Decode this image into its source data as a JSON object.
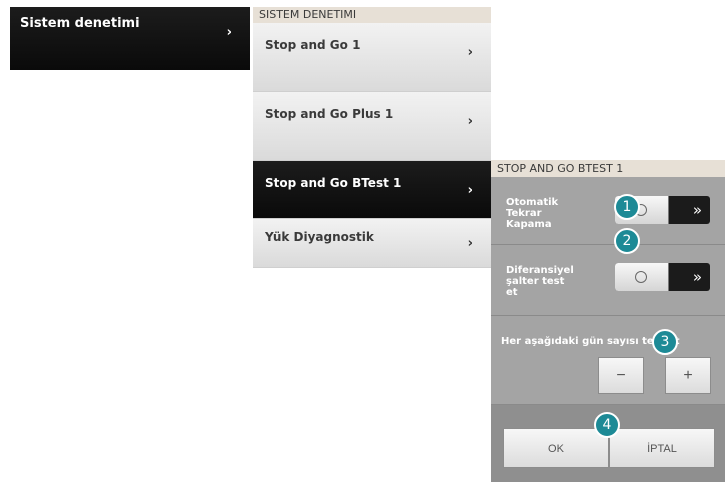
{
  "panel1": {
    "label": "Sistem denetimi",
    "chevron": "›"
  },
  "panel2": {
    "header": "SISTEM DENETIMI",
    "items": [
      {
        "label": "Stop and Go 1",
        "chevron": "›"
      },
      {
        "label": "Stop and Go Plus 1",
        "chevron": "›"
      },
      {
        "label": "Stop and Go BTest 1",
        "chevron": "›"
      },
      {
        "label": "Yük Diyagnostik",
        "chevron": "›"
      }
    ]
  },
  "panel3": {
    "header": "STOP AND GO BTEST 1",
    "toggle1": {
      "label_lines": [
        "Otomatik",
        "Tekrar",
        "Kapama"
      ],
      "arrow": "»"
    },
    "toggle2": {
      "label_lines": [
        "Diferansiyel",
        "şalter test",
        "et"
      ],
      "arrow": "»"
    },
    "days_label": "Her aşağıdaki gün sayısı test et",
    "minus": "−",
    "plus": "+",
    "ok": "OK",
    "cancel": "İPTAL"
  },
  "badges": [
    "1",
    "2",
    "3",
    "4"
  ],
  "colors": {
    "badge": "#1d8a96",
    "header_bg": "#e7e0d6",
    "dark_bg": "#111111",
    "panel_gray": "#a4a4a4"
  }
}
